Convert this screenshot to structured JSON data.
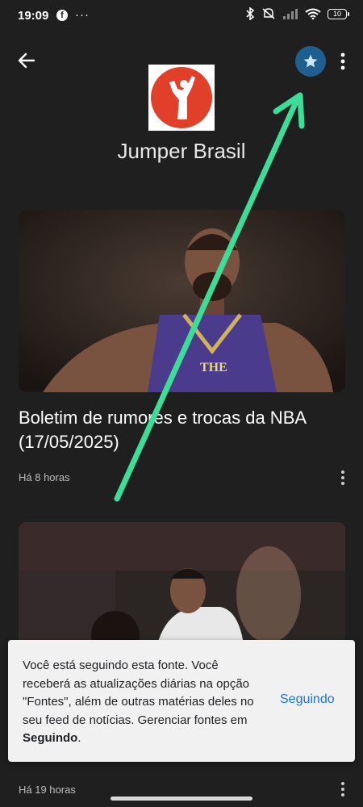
{
  "status_bar": {
    "time": "19:09",
    "battery": "10"
  },
  "header": {
    "source_name": "Jumper Brasil"
  },
  "articles": [
    {
      "title": "Boletim de rumores e trocas da NBA (17/05/2025)",
      "time_ago": "Há 8 horas"
    },
    {
      "time_ago": "Há 19 horas"
    }
  ],
  "toast": {
    "message_prefix": "Você está seguindo esta fonte. Você receberá as atualizações diárias na opção \"Fontes\", além de outras matérias deles no seu feed de notícias. Gerenciar fontes em ",
    "message_bold": "Seguindo",
    "message_suffix": ".",
    "action_label": "Seguindo"
  },
  "colors": {
    "background": "#1f1f1f",
    "star_button": "#1f5f8f",
    "toast_bg": "#f1f1f1",
    "toast_action": "#1a73e8",
    "annotation_arrow": "#3ddc97"
  },
  "icons": [
    "facebook-icon",
    "bluetooth-icon",
    "mute-icon",
    "signal-icon",
    "wifi-icon",
    "battery-icon",
    "back-arrow-icon",
    "star-icon",
    "more-vert-icon"
  ]
}
